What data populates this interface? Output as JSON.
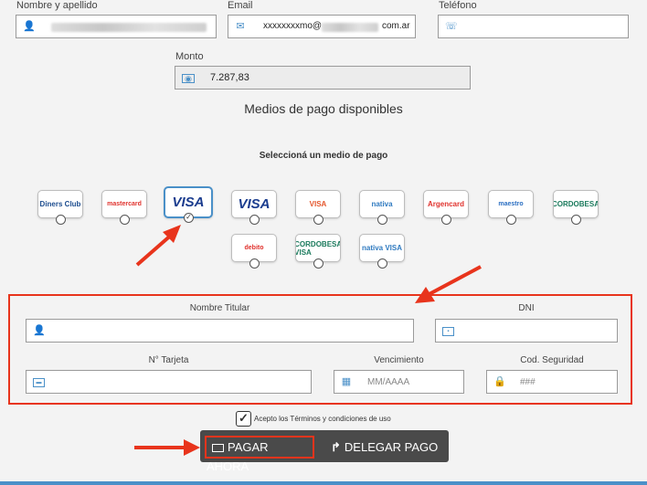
{
  "form": {
    "name_label": "Nombre y apellido",
    "email_label": "Email",
    "email_value_prefix": "xxxxxxxxmo@",
    "email_value_suffix": "com.ar",
    "phone_label": "Teléfono",
    "amount_label": "Monto",
    "amount_value": "7.287,83"
  },
  "payment": {
    "title": "Medios de pago disponibles",
    "subtitle": "Seleccioná un medio de pago",
    "cards": [
      {
        "name": "Diners Club",
        "logo": "diners-club-icon"
      },
      {
        "name": "mastercard",
        "logo": "mastercard-icon"
      },
      {
        "name": "VISA",
        "logo": "visa-icon"
      },
      {
        "name": "VISA",
        "logo": "visa-debit-icon"
      },
      {
        "name": "VISA",
        "logo": "naranja-visa-icon"
      },
      {
        "name": "nativa",
        "logo": "nativa-icon"
      },
      {
        "name": "Argencard",
        "logo": "argencard-icon"
      },
      {
        "name": "maestro",
        "logo": "maestro-icon"
      },
      {
        "name": "CORDOBESA",
        "logo": "cordobesa-icon"
      },
      {
        "name": "debito",
        "logo": "mastercard-debit-icon"
      },
      {
        "name": "CORDOBESA VISA",
        "logo": "cordobesa-visa-icon"
      },
      {
        "name": "nativa VISA",
        "logo": "nativa-visa-icon"
      }
    ]
  },
  "card_form": {
    "holder_label": "Nombre Titular",
    "dni_label": "DNI",
    "card_number_label": "N° Tarjeta",
    "expiry_label": "Vencimiento",
    "expiry_placeholder": "MM/AAAA",
    "cvv_label": "Cod. Seguridad",
    "cvv_placeholder": "###"
  },
  "terms": {
    "label": "Acepto los Términos y condiciones de uso"
  },
  "actions": {
    "pay": "PAGAR AHORA",
    "delegate": "DELEGAR PAGO"
  },
  "colors": {
    "accent": "#4a90c8",
    "highlight": "#e8341c",
    "button_bg": "#4a4a4a"
  }
}
